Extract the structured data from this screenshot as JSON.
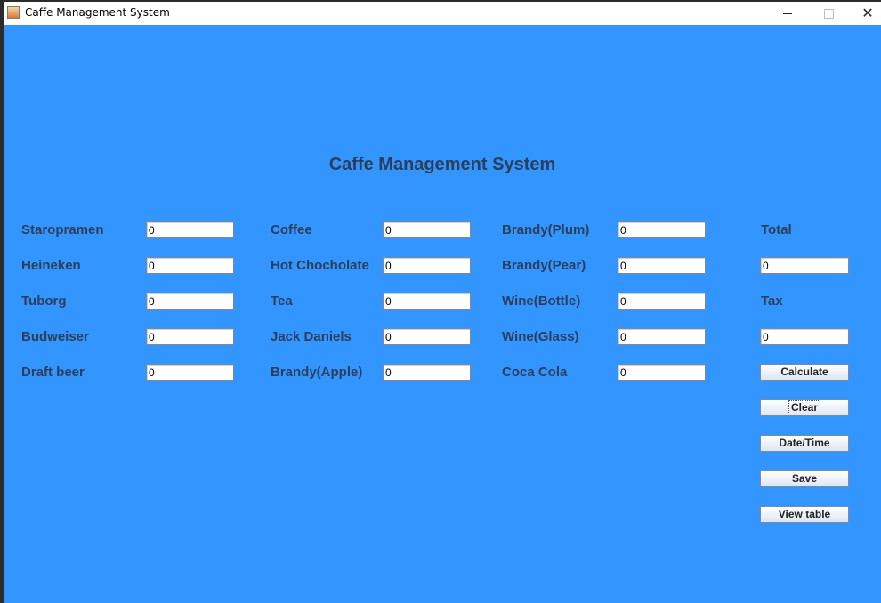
{
  "window": {
    "title": "Caffe Management System",
    "controls": {
      "minimize": "",
      "maximize": "",
      "close": "✕"
    }
  },
  "heading": "Caffe Management System",
  "columns": [
    {
      "items": [
        {
          "label": "Staropramen",
          "value": "0"
        },
        {
          "label": "Heineken",
          "value": "0"
        },
        {
          "label": "Tuborg",
          "value": "0"
        },
        {
          "label": "Budweiser",
          "value": "0"
        },
        {
          "label": "Draft beer",
          "value": "0"
        }
      ]
    },
    {
      "items": [
        {
          "label": "Coffee",
          "value": "0"
        },
        {
          "label": "Hot Chocholate",
          "value": "0"
        },
        {
          "label": "Tea",
          "value": "0"
        },
        {
          "label": "Jack Daniels",
          "value": "0"
        },
        {
          "label": "Brandy(Apple)",
          "value": "0"
        }
      ]
    },
    {
      "items": [
        {
          "label": "Brandy(Plum)",
          "value": "0"
        },
        {
          "label": "Brandy(Pear)",
          "value": "0"
        },
        {
          "label": "Wine(Bottle)",
          "value": "0"
        },
        {
          "label": "Wine(Glass)",
          "value": "0"
        },
        {
          "label": "Coca Cola",
          "value": "0"
        }
      ]
    }
  ],
  "summary": {
    "total_label": "Total",
    "total_value": "0",
    "tax_label": "Tax",
    "tax_value": "0"
  },
  "buttons": {
    "calculate": "Calculate",
    "clear": "Clear",
    "datetime": "Date/Time",
    "save": "Save",
    "view_table": "View table"
  },
  "colors": {
    "background": "#3395ff",
    "label_text": "#2c3f5a"
  }
}
